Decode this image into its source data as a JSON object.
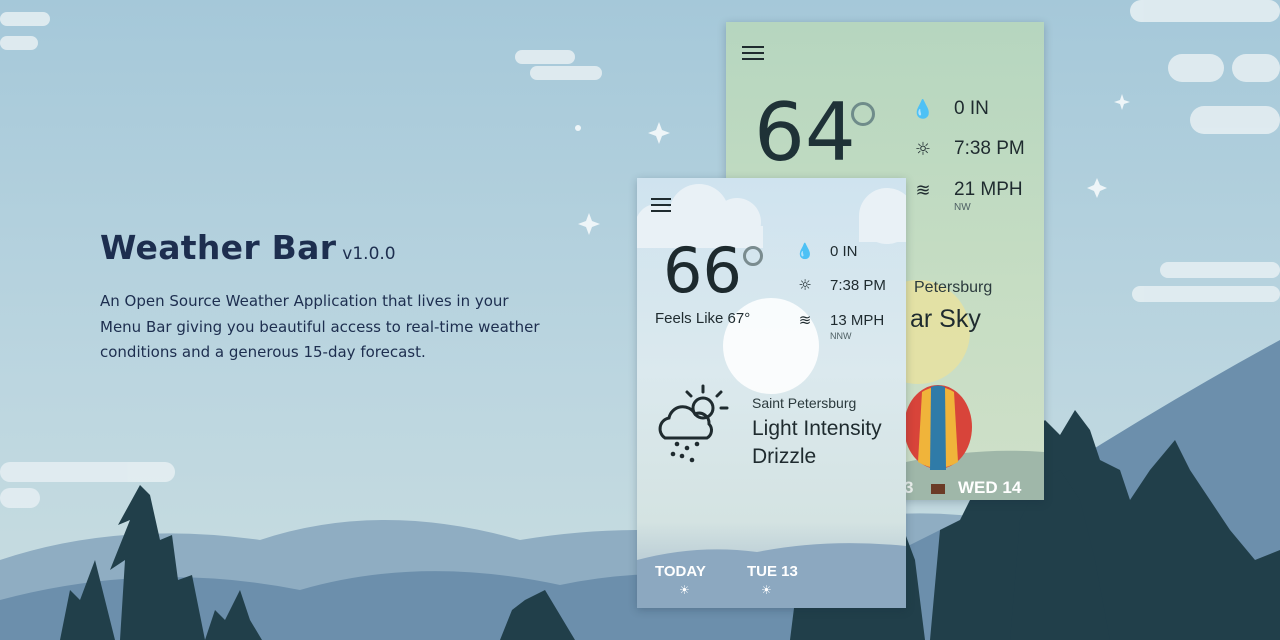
{
  "hero": {
    "title": "Weather Bar",
    "version": "v1.0.0",
    "description": "An Open Source Weather Application that lives in your Menu Bar giving you beautiful access to real-time weather conditions and a generous 15-day forecast."
  },
  "back_card": {
    "temperature": "64",
    "precipitation": "0 IN",
    "sunset": "7:38 PM",
    "wind": "21 MPH",
    "wind_dir": "NW",
    "location_partial": "Petersburg",
    "condition_partial": "ar Sky",
    "day_partial_left": "3",
    "day_label": "WED 14"
  },
  "front_card": {
    "temperature": "66",
    "feels_like": "Feels Like 67°",
    "precipitation": "0 IN",
    "sunset": "7:38 PM",
    "wind": "13 MPH",
    "wind_dir": "NNW",
    "location": "Saint Petersburg",
    "condition_line1": "Light Intensity",
    "condition_line2": "Drizzle",
    "days": [
      "TODAY",
      "TUE 13"
    ]
  },
  "colors": {
    "sky": "#a9cadb",
    "mountain_far": "#7fa0b8",
    "mountain_mid": "#5d82a0",
    "trees": "#1f3f48",
    "title": "#1d2e4f"
  }
}
